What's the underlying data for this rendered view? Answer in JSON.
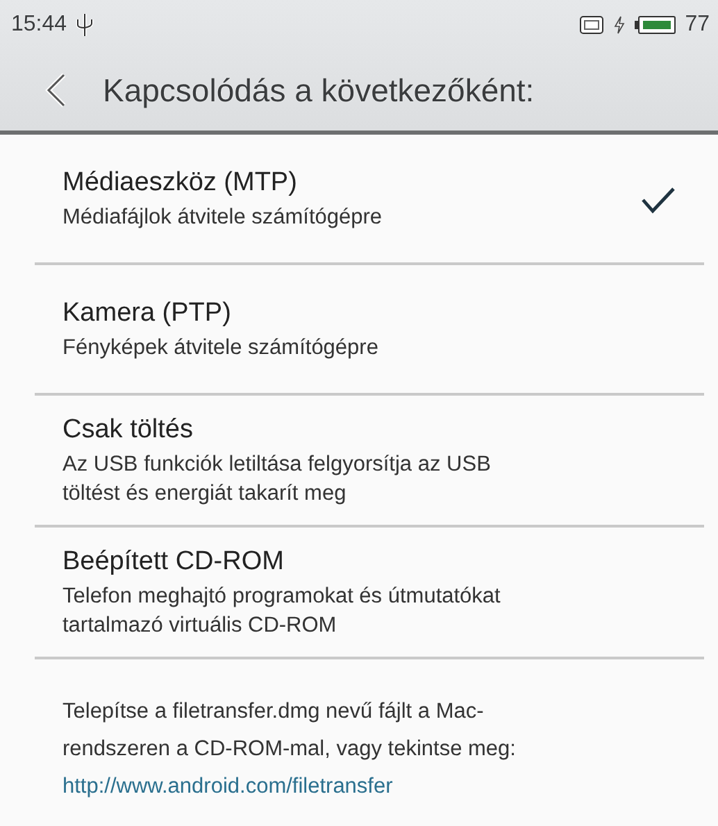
{
  "status_bar": {
    "time": "15:44",
    "battery_percent": "77"
  },
  "header": {
    "title": "Kapcsolódás a következőként:"
  },
  "options": [
    {
      "title": "Médiaeszköz (MTP)",
      "subtitle": "Médiafájlok átvitele számítógépre",
      "selected": true
    },
    {
      "title": "Kamera (PTP)",
      "subtitle": "Fényképek átvitele számítógépre",
      "selected": false
    },
    {
      "title": "Csak töltés",
      "subtitle": "Az USB funkciók letiltása felgyorsítja az USB töltést és energiát takarít meg",
      "selected": false
    },
    {
      "title": "Beépített CD-ROM",
      "subtitle": "Telefon meghajtó programokat és útmutatókat tartalmazó virtuális CD-ROM",
      "selected": false
    }
  ],
  "footer": {
    "text": "Telepítse a filetransfer.dmg nevű fájlt a Mac-rendszeren a CD-ROM-mal, vagy tekintse meg:",
    "link": "http://www.android.com/filetransfer"
  }
}
